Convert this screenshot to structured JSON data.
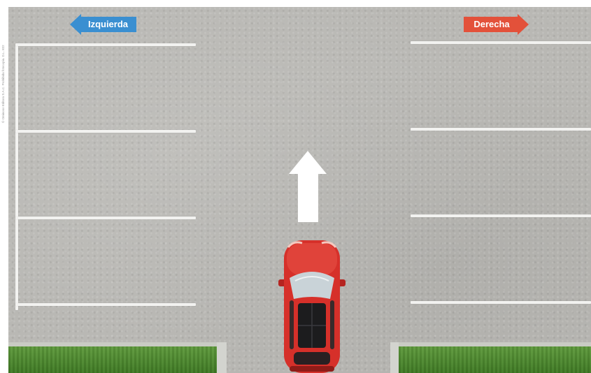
{
  "signs": {
    "left_label": "Izquierda",
    "right_label": "Derecha",
    "left_color": "#3a8fd1",
    "right_color": "#e3513a"
  },
  "copyright": "© Ominoso Editora S.A.C. Prohibida fotocopia. D.L. 822",
  "icons": {
    "forward_arrow": "up-arrow-icon",
    "car": "red-car-top-view"
  },
  "colors": {
    "asphalt": "#b9b8b4",
    "lines": "#f2f2f0",
    "grass": "#4f8a30",
    "car_body": "#d6302a"
  }
}
